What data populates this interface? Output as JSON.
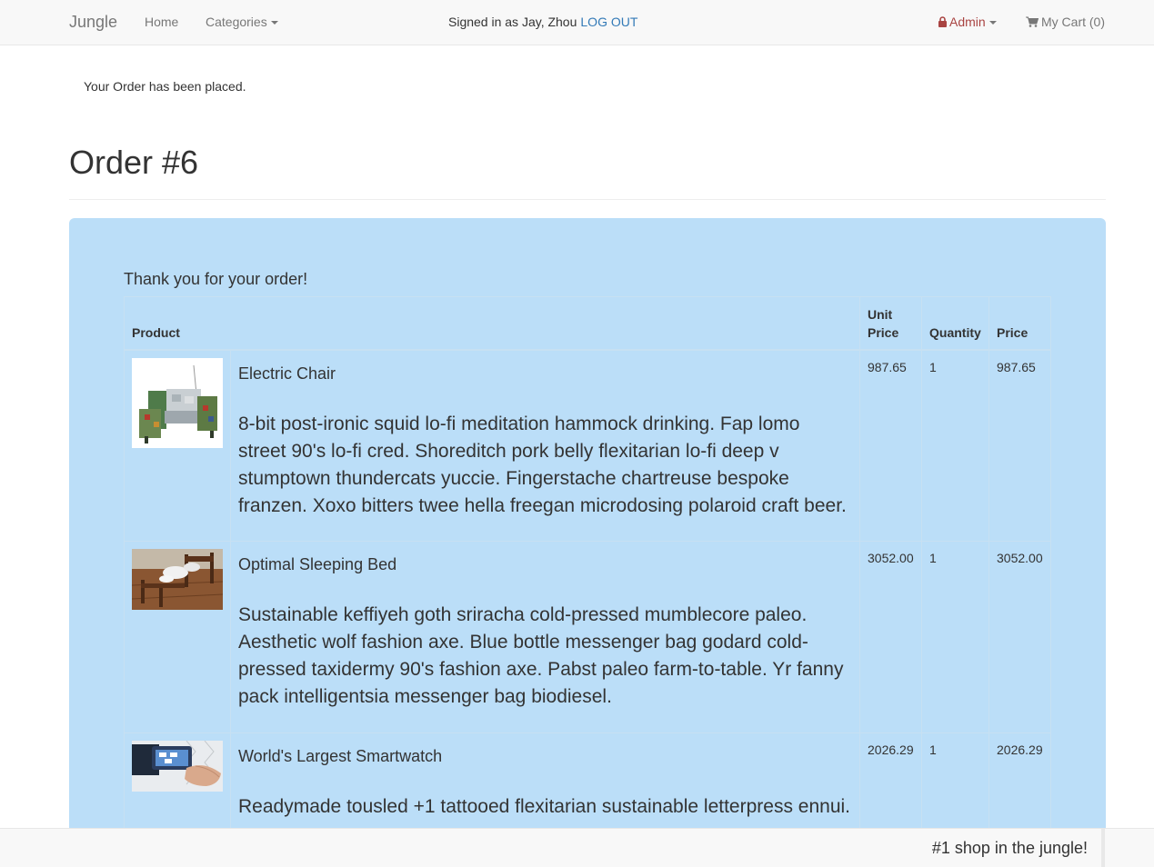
{
  "navbar": {
    "brand": "Jungle",
    "home": "Home",
    "categories": "Categories",
    "signed_in": "Signed in as Jay, Zhou",
    "logout": "LOG OUT",
    "admin": "Admin",
    "cart": "My Cart (0)"
  },
  "notice": "Your Order has been placed.",
  "order": {
    "title": "Order #6",
    "thanks": "Thank you for your order!",
    "columns": {
      "product": "Product",
      "unit_price_1": "Unit",
      "unit_price_2": "Price",
      "quantity": "Quantity",
      "price": "Price"
    },
    "items": [
      {
        "name": "Electric Chair",
        "description": "8-bit post-ironic squid lo-fi meditation hammock drinking. Fap lomo street 90's lo-fi cred. Shoreditch pork belly flexitarian lo-fi deep v stumptown thundercats yuccie. Fingerstache chartreuse bespoke franzen. Xoxo bitters twee hella freegan microdosing polaroid craft beer.",
        "unit_price": "987.65",
        "quantity": "1",
        "price": "987.65"
      },
      {
        "name": "Optimal Sleeping Bed",
        "description": "Sustainable keffiyeh goth sriracha cold-pressed mumblecore paleo. Aesthetic wolf fashion axe. Blue bottle messenger bag godard cold-pressed taxidermy 90's fashion axe. Pabst paleo farm-to-table. Yr fanny pack intelligentsia messenger bag biodiesel.",
        "unit_price": "3052.00",
        "quantity": "1",
        "price": "3052.00"
      },
      {
        "name": "World's Largest Smartwatch",
        "description": "Readymade tousled +1 tattooed flexitarian sustainable letterpress ennui.",
        "unit_price": "2026.29",
        "quantity": "1",
        "price": "2026.29"
      }
    ]
  },
  "footer": {
    "tagline": "#1 shop in the jungle!"
  },
  "colors": {
    "panel": "#bbdef8",
    "link": "#337ab7",
    "admin": "#a94442"
  }
}
